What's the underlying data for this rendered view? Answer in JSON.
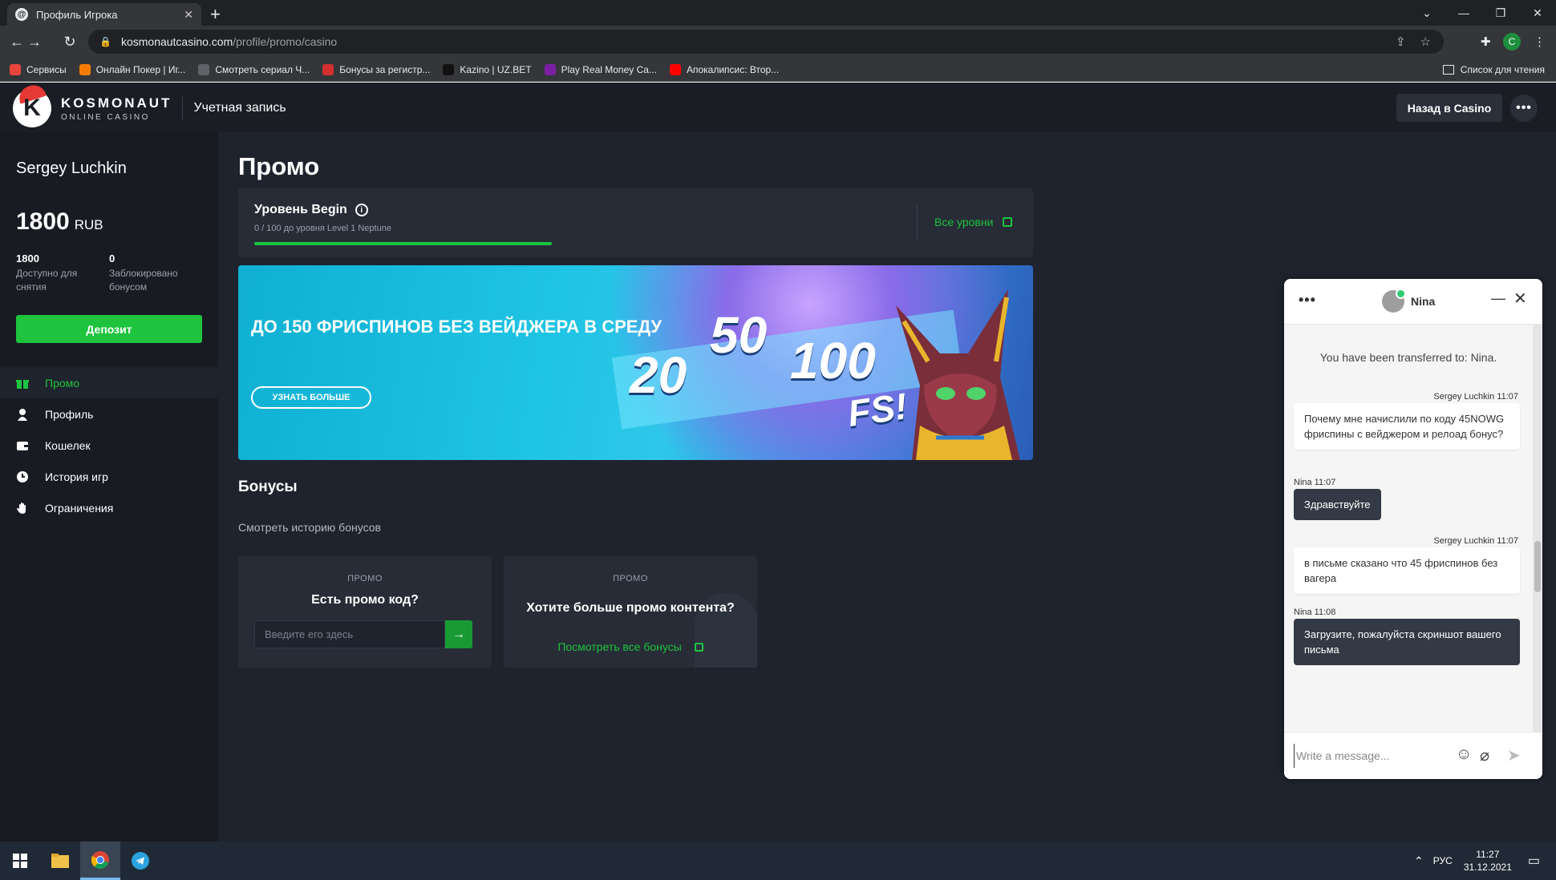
{
  "browser": {
    "tab_title": "Профиль Игрока",
    "tab_favicon": "@",
    "url_host": "kosmonautcasino.com",
    "url_path": "/profile/promo/casino",
    "profile_letter": "C",
    "bookmarks": [
      {
        "label": "Сервисы",
        "color": "#e8453c"
      },
      {
        "label": "Онлайн Покер | Иг...",
        "color": "#f57c00"
      },
      {
        "label": "Смотреть сериал Ч...",
        "color": "#5f6368"
      },
      {
        "label": "Бонусы за регистр...",
        "color": "#d32f2f"
      },
      {
        "label": "Kazino | UZ.BET",
        "color": "#111111"
      },
      {
        "label": "Play Real Money Ca...",
        "color": "#7b1fa2"
      },
      {
        "label": "Апокалипсис: Втор...",
        "color": "#ff0000"
      }
    ],
    "reading_list": "Список для чтения"
  },
  "header": {
    "logo_main": "KOSMONAUT",
    "logo_sub": "ONLINE CASINO",
    "logo_letter": "K",
    "account_label": "Учетная запись",
    "back_button": "Назад в Casino",
    "more_button": "•••"
  },
  "sidebar": {
    "user_name": "Sergey Luchkin",
    "balance": "1800",
    "currency": "RUB",
    "available_value": "1800",
    "available_desc": "Доступно для снятия",
    "locked_value": "0",
    "locked_desc": "Заблокировано бонусом",
    "deposit_button": "Депозит",
    "menu": [
      {
        "label": "Промо",
        "icon": "gift-icon"
      },
      {
        "label": "Профиль",
        "icon": "user-icon"
      },
      {
        "label": "Кошелек",
        "icon": "wallet-icon"
      },
      {
        "label": "История игр",
        "icon": "clock-icon"
      },
      {
        "label": "Ограничения",
        "icon": "hand-icon"
      }
    ]
  },
  "main": {
    "title": "Промо",
    "level": {
      "name": "Уровень Begin",
      "progress_text": "0 / 100 до уровня Level 1 Neptune",
      "all_levels": "Все уровни"
    },
    "banner": {
      "title": "ДО 150 ФРИСПИНОВ БЕЗ ВЕЙДЖЕРА В СРЕДУ",
      "button": "УЗНАТЬ БОЛЬШЕ",
      "num1": "20",
      "num2": "50",
      "num3": "100",
      "fs": "FS!"
    },
    "bonuses_title": "Бонусы",
    "bonus_history": "Смотреть историю бонусов",
    "promo_card": {
      "label": "ПРОМО",
      "title": "Есть промо код?",
      "placeholder": "Введите его здесь"
    },
    "content_card": {
      "label": "ПРОМО",
      "title": "Хотите больше промо контента?",
      "link": "Посмотреть все бонусы"
    }
  },
  "chat": {
    "agent_name": "Nina",
    "system_message": "You have been transferred to: Nina.",
    "messages": [
      {
        "meta": "Sergey Luchkin 11:07",
        "text": "Почему мне начислили по коду 45NOWG фриспины с вейджером и релоад бонус?"
      },
      {
        "meta": "Nina 11:07",
        "text": "Здравствуйте"
      },
      {
        "meta": "Sergey Luchkin 11:07",
        "text": "в письме сказано что 45 фриспинов без вагера"
      },
      {
        "meta": "Nina 11:08",
        "text": "Загрузите, пожалуйста скриншот вашего письма"
      }
    ],
    "input_placeholder": "Write a message..."
  },
  "taskbar": {
    "lang": "РУС",
    "time": "11:27",
    "date": "31.12.2021"
  },
  "colors": {
    "accent_green": "#1ec43e",
    "site_bg": "#1f232d",
    "sidebar_bg": "#181b22",
    "card_bg": "#272c37"
  }
}
